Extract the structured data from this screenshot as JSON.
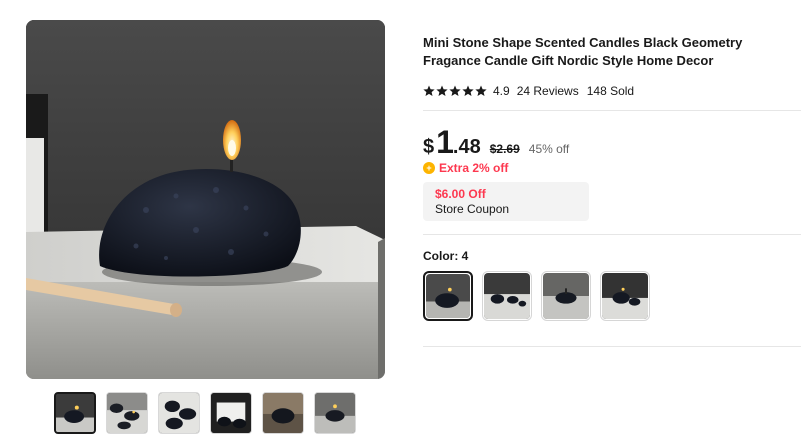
{
  "product": {
    "title": "Mini Stone Shape Scented Candles Black Geometry Fragance Candle Gift Nordic Style Home Decor",
    "rating": {
      "stars": 5,
      "score": "4.9",
      "reviews": "24 Reviews",
      "sold": "148 Sold"
    }
  },
  "price": {
    "currency": "$",
    "integer": "1",
    "decimal": ".48",
    "original": "$2.69",
    "discount": "45% off",
    "extra_discount": "Extra 2% off"
  },
  "coupon": {
    "amount": "$6.00 Off",
    "label": "Store Coupon"
  },
  "color": {
    "label": "Color: 4",
    "options_count": 4,
    "selected_index": 0
  },
  "gallery": {
    "thumbnail_count": 6,
    "selected_index": 0
  },
  "colors": {
    "accent_red": "#fd384f",
    "coin_yellow": "#fdb400",
    "text": "#191919",
    "muted": "#666666"
  }
}
